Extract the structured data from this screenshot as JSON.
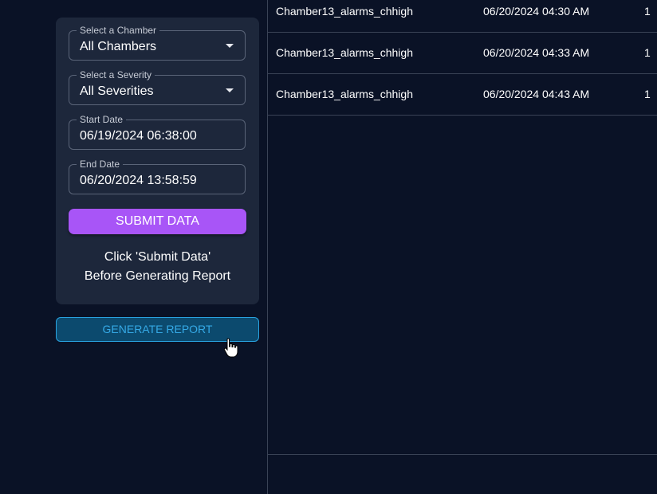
{
  "filters": {
    "chamber": {
      "label": "Select a Chamber",
      "value": "All Chambers"
    },
    "severity": {
      "label": "Select a Severity",
      "value": "All Severities"
    },
    "start_date": {
      "label": "Start Date",
      "value": "06/19/2024 06:38:00"
    },
    "end_date": {
      "label": "End Date",
      "value": "06/20/2024 13:58:59"
    },
    "submit_label": "SUBMIT DATA",
    "hint_line1": "Click 'Submit Data'",
    "hint_line2": "Before Generating Report"
  },
  "generate_label": "GENERATE REPORT",
  "results": [
    {
      "name": "Chamber13_alarms_chhigh",
      "time": "06/20/2024 04:30 AM",
      "count": "1"
    },
    {
      "name": "Chamber13_alarms_chhigh",
      "time": "06/20/2024 04:33 AM",
      "count": "1"
    },
    {
      "name": "Chamber13_alarms_chhigh",
      "time": "06/20/2024 04:43 AM",
      "count": "1"
    }
  ],
  "colors": {
    "submit": "#a855f7",
    "generate_border": "#29a3e0",
    "background": "#0a1226"
  }
}
